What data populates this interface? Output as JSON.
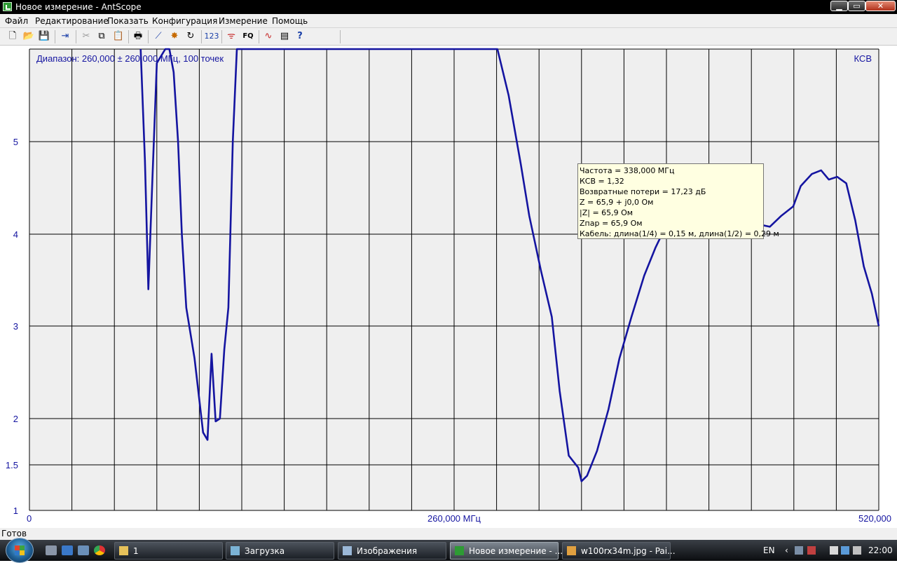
{
  "window": {
    "title": "Новое измерение - AntScope",
    "controls": {
      "minimize": "▁",
      "maximize": "▭",
      "close": "✕"
    }
  },
  "menu": [
    "Файл",
    "Редактирование",
    "Показать",
    "Конфигурация",
    "Измерение",
    "Помощь"
  ],
  "toolbar": {
    "icons": [
      "new-file-icon",
      "open-folder-icon",
      "save-icon",
      "export-icon",
      "cut-icon",
      "copy-icon",
      "paste-icon",
      "print-icon",
      "chart-icon",
      "mark-icon",
      "refresh-icon",
      "numbers-icon",
      "antenna-icon",
      "fq-icon",
      "wave-icon",
      "list-icon",
      "help-icon"
    ],
    "labels": {
      "numbers": "123",
      "fq": "FQ"
    }
  },
  "chart_data": {
    "type": "line",
    "header": "Диапазон: 260,000 ± 260,000 МГц, 100 точек",
    "series_label": "КСВ",
    "xlim": [
      0,
      520
    ],
    "ylim": [
      1,
      6
    ],
    "y_scale": "КСВ (nonlinear: 1, 1.5, 2, 3, 4, 5)",
    "x_ticks": [
      {
        "value": 0,
        "label": "0"
      },
      {
        "value": 260,
        "label": "260,000 МГц"
      },
      {
        "value": 520,
        "label": "520,000"
      }
    ],
    "y_ticks": [
      {
        "value": 1,
        "label": "1"
      },
      {
        "value": 1.5,
        "label": "1.5"
      },
      {
        "value": 2,
        "label": "2"
      },
      {
        "value": 3,
        "label": "3"
      },
      {
        "value": 4,
        "label": "4"
      },
      {
        "value": 5,
        "label": "5"
      }
    ],
    "grid": true,
    "x_gridlines": 20,
    "series": [
      {
        "color": "#1414a0",
        "x": [
          68.1,
          70.7,
          72.8,
          75.3,
          78.0,
          83.2,
          85.7,
          88.3,
          91.0,
          93.3,
          96.0,
          101.1,
          106.3,
          109.0,
          111.5,
          114.0,
          116.6,
          119.3,
          121.8,
          124.5,
          127.0,
          129.8,
          132.2,
          134.9,
          137.5,
          140.1,
          142.7,
          145.2,
          147.8,
          150.5,
          153.1,
          155.5,
          158.3,
          160.8,
          163.3,
          166.0,
          168.6,
          171.2,
          173.7,
          176.4,
          179.0,
          181.5,
          184.1,
          186.8,
          189.3,
          192.0,
          194.5,
          197.1,
          199.7,
          202.3,
          204.9,
          207.5,
          210.0,
          212.7,
          215.3,
          217.8,
          220.4,
          223.1,
          225.6,
          228.2,
          230.8,
          233.4,
          236.1,
          238.6,
          241.2,
          243.8,
          246.4,
          249.0,
          251.5,
          254.1,
          256.7,
          259.3,
          261.9,
          264.6,
          267.1,
          269.7,
          272.2,
          274.9,
          277.5,
          280.1,
          286.5,
          293.4,
          300.9,
          306.0,
          313.2,
          319.8,
          324.6,
          330.2,
          336.0,
          338.0,
          341.4,
          347.5,
          354.5,
          361.2,
          368.6,
          376.4,
          383.2,
          390.0,
          395.1,
          400.4,
          405.0,
          411.5,
          418.6,
          425.0,
          431.5,
          438.4,
          443.3,
          448.1,
          453.3,
          460.4,
          467.6,
          472.2,
          479.0,
          484.7,
          489.4,
          494.5,
          500.1,
          505.6,
          510.8,
          515.8,
          520.0
        ],
        "y": [
          6.0,
          4.8,
          3.4,
          4.6,
          5.85,
          6.0,
          6.0,
          5.75,
          5.0,
          4.0,
          3.2,
          2.65,
          1.85,
          1.77,
          2.7,
          1.97,
          2.0,
          2.75,
          3.2,
          5.0,
          6.0,
          6.0,
          6.0,
          6.0,
          6.0,
          6.0,
          6.0,
          6.0,
          6.0,
          6.0,
          6.0,
          6.0,
          6.0,
          6.0,
          6.0,
          6.0,
          6.0,
          6.0,
          6.0,
          6.0,
          6.0,
          6.0,
          6.0,
          6.0,
          6.0,
          6.0,
          6.0,
          6.0,
          6.0,
          6.0,
          6.0,
          6.0,
          6.0,
          6.0,
          6.0,
          6.0,
          6.0,
          6.0,
          6.0,
          6.0,
          6.0,
          6.0,
          6.0,
          6.0,
          6.0,
          6.0,
          6.0,
          6.0,
          6.0,
          6.0,
          6.0,
          6.0,
          6.0,
          6.0,
          6.0,
          6.0,
          6.0,
          6.0,
          6.0,
          6.0,
          6.0,
          5.5,
          4.75,
          4.2,
          3.6,
          3.1,
          2.3,
          1.6,
          1.47,
          1.32,
          1.38,
          1.65,
          2.1,
          2.65,
          3.1,
          3.55,
          3.85,
          4.1,
          4.23,
          4.32,
          4.27,
          4.16,
          4.13,
          4.08,
          4.03,
          4.07,
          4.06,
          4.1,
          4.08,
          4.2,
          4.3,
          4.52,
          4.65,
          4.69,
          4.59,
          4.62,
          4.55,
          4.15,
          3.65,
          3.35,
          3.0
        ]
      }
    ]
  },
  "tooltip": {
    "lines": [
      "Частота = 338,000 МГц",
      "КСВ = 1,32",
      "Возвратные потери = 17,23 дБ",
      "Z = 65,9 + j0,0 Ом",
      "|Z| = 65,9 Ом",
      "Zпар = 65,9 Ом",
      "Кабель: длина(1/4) = 0,15 м, длина(1/2) = 0,29 м"
    ]
  },
  "status": {
    "text": "Готов"
  },
  "taskbar": {
    "tasks": [
      {
        "label": "1",
        "icon": "folder-icon",
        "active": false
      },
      {
        "label": "Загрузка",
        "icon": "app-icon",
        "active": false
      },
      {
        "label": "Изображения",
        "icon": "folder-icon",
        "active": false
      },
      {
        "label": "Новое измерение - ...",
        "icon": "antscope-icon",
        "active": true
      },
      {
        "label": "w100rx34m.jpg - Pai...",
        "icon": "paint-icon",
        "active": false
      }
    ],
    "language": "EN",
    "time": "22:00"
  },
  "colors": {
    "chart_bg": "#efefef",
    "grid": "#000000",
    "series": "#1414a0",
    "axis_text": "#1414a0",
    "tooltip_bg": "#ffffe1"
  }
}
